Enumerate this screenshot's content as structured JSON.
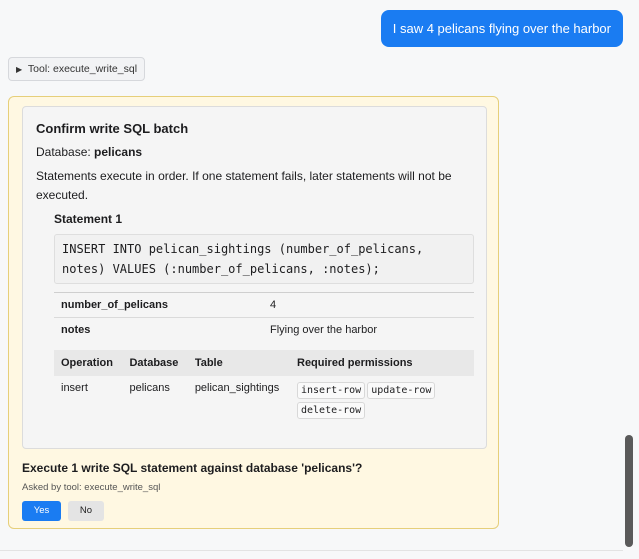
{
  "user_message": "I saw 4 pelicans flying over the harbor",
  "tool_toggle": {
    "arrow": "▶",
    "label": "Tool: execute_write_sql"
  },
  "confirm": {
    "title": "Confirm write SQL batch",
    "database_prefix": "Database: ",
    "database_name": "pelicans",
    "note": "Statements execute in order. If one statement fails, later statements will not be executed.",
    "statement": {
      "heading": "Statement 1",
      "sql": "INSERT INTO pelican_sightings (number_of_pelicans, notes) VALUES (:number_of_pelicans, :notes);",
      "params": [
        {
          "name": "number_of_pelicans",
          "value": "4"
        },
        {
          "name": "notes",
          "value": "Flying over the harbor"
        }
      ],
      "ops_headers": [
        "Operation",
        "Database",
        "Table",
        "Required permissions"
      ],
      "ops_row": {
        "operation": "insert",
        "database": "pelicans",
        "table": "pelican_sightings",
        "permissions": [
          "insert-row",
          "update-row",
          "delete-row"
        ]
      }
    },
    "question": "Execute 1 write SQL statement against database 'pelicans'?",
    "asked_by": "Asked by tool: execute_write_sql",
    "yes_label": "Yes",
    "no_label": "No"
  },
  "colors": {
    "accent": "#1a7cf2",
    "card_bg": "#fff8e2",
    "card_border": "#e6cf7a"
  }
}
